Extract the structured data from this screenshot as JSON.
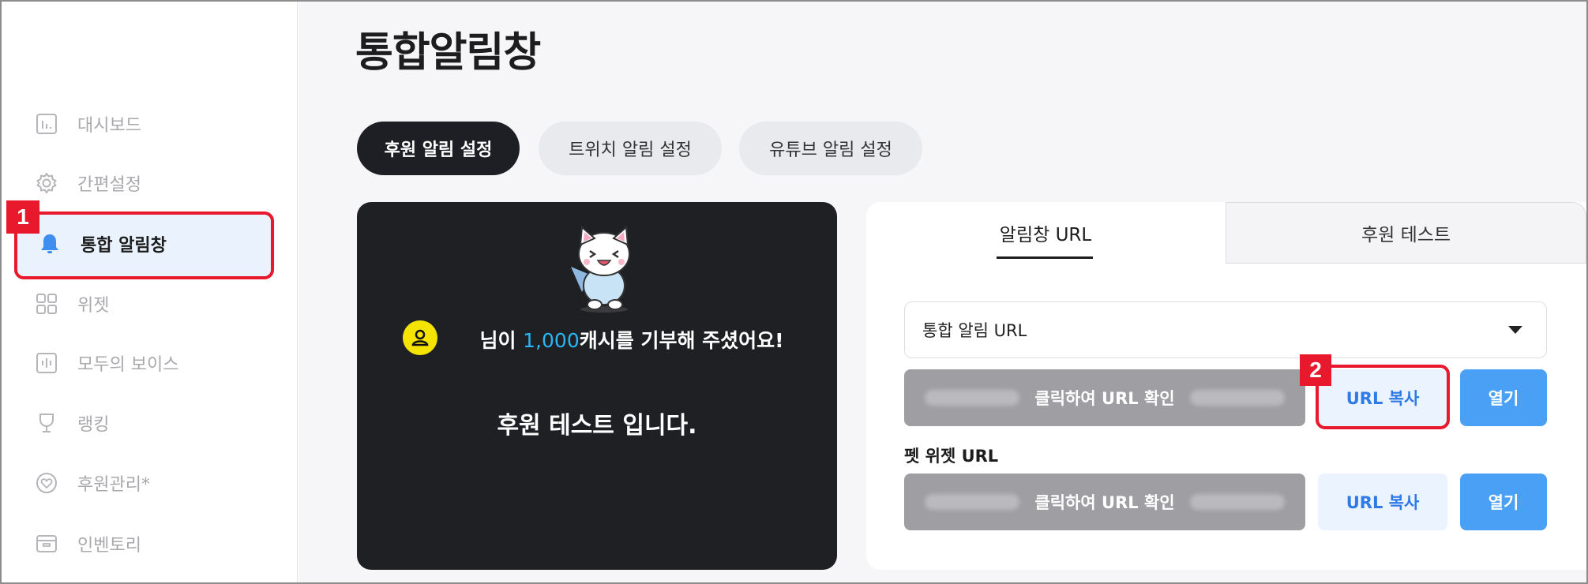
{
  "sidebar": {
    "items": [
      {
        "label": "대시보드",
        "icon": "chart-icon"
      },
      {
        "label": "간편설정",
        "icon": "gear-icon"
      },
      {
        "label": "통합 알림창",
        "icon": "bell-icon"
      },
      {
        "label": "위젯",
        "icon": "grid-icon"
      },
      {
        "label": "모두의 보이스",
        "icon": "waveform-icon"
      },
      {
        "label": "랭킹",
        "icon": "trophy-icon"
      },
      {
        "label": "후원관리*",
        "icon": "heart-icon"
      },
      {
        "label": "인벤토리",
        "icon": "box-icon"
      }
    ]
  },
  "page": {
    "title": "통합알림창"
  },
  "tabs": [
    {
      "label": "후원 알림 설정"
    },
    {
      "label": "트위치 알림 설정"
    },
    {
      "label": "유튜브 알림 설정"
    }
  ],
  "preview": {
    "message_pre": "님이 ",
    "amount": "1,000",
    "message_post": "캐시를 기부해 주셨어요!",
    "sub_message": "후원 테스트 입니다."
  },
  "panel": {
    "tabs": [
      {
        "label": "알림창 URL"
      },
      {
        "label": "후원 테스트"
      }
    ],
    "select_value": "통합 알림 URL",
    "url_box_label": "클릭하여 URL 확인",
    "copy_label": "URL 복사",
    "open_label": "열기",
    "pet_widget_label": "펫 위젯 URL"
  },
  "annotations": {
    "badge1": "1",
    "badge2": "2"
  },
  "colors": {
    "accent": "#4aa0f5",
    "dark": "#1f2024",
    "highlight": "#e8192c",
    "amount": "#29b6f6"
  }
}
